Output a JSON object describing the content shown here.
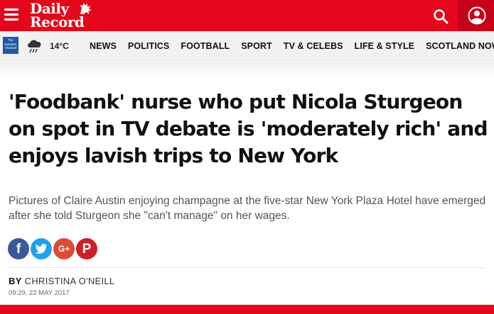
{
  "colors": {
    "brand_red": "#e4061b",
    "account_red": "#c8001a",
    "nav_bg": "#f1f1f1"
  },
  "header": {
    "logo_line1": "Daily",
    "logo_line2": "Record",
    "menu_icon": "hamburger-menu-icon",
    "search_icon": "search-icon",
    "account_icon": "user-account-icon"
  },
  "weather": {
    "provider_text": "The Weather Channel",
    "icon": "rain-cloud-icon",
    "temperature": "14°C"
  },
  "nav": {
    "items": [
      "NEWS",
      "POLITICS",
      "FOOTBALL",
      "SPORT",
      "TV & CELEBS",
      "LIFE & STYLE",
      "SCOTLAND NOW"
    ]
  },
  "article": {
    "headline": "'Foodbank' nurse who put Nicola Sturgeon on spot in TV debate is 'moderately rich' and enjoys lavish trips to New York",
    "standfirst": "Pictures of Claire Austin enjoying champagne at the five-star New York Plaza Hotel have emerged after she told Sturgeon she \"can't manage\" on her wages.",
    "share": {
      "facebook": "f",
      "twitter": "twitter-icon",
      "googleplus": "G+",
      "pinterest": "P"
    },
    "byline_prefix": "BY",
    "author": "CHRISTINA O'NEILL",
    "date": "09:29, 22 MAY 2017"
  }
}
